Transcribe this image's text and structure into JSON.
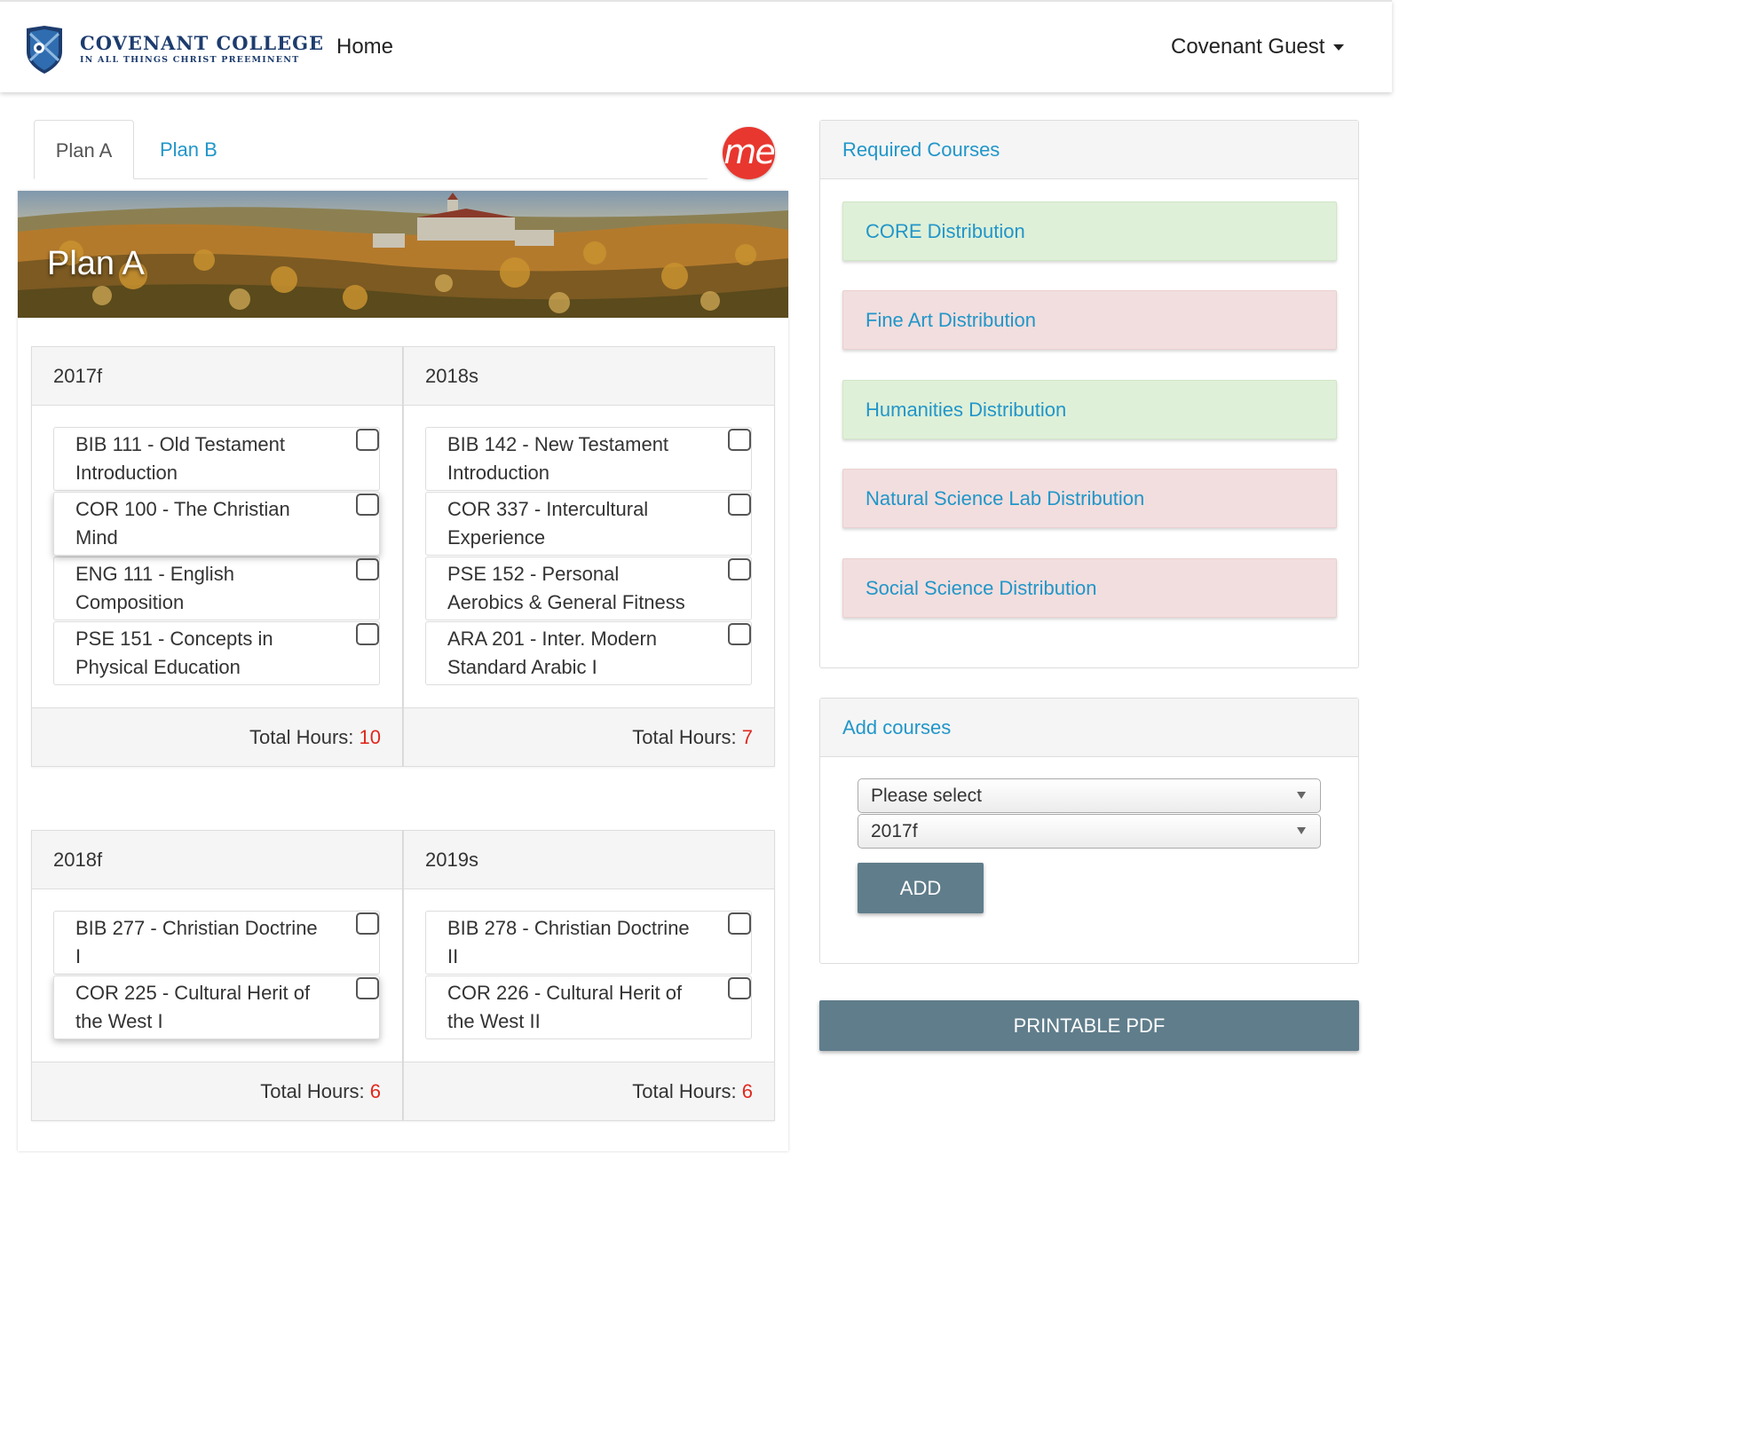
{
  "navbar": {
    "brand_name": "COVENANT COLLEGE",
    "brand_motto": "IN ALL THINGS CHRIST PREEMINENT",
    "home": "Home",
    "user": "Covenant Guest"
  },
  "tabs": [
    {
      "label": "Plan A",
      "active": true
    },
    {
      "label": "Plan B",
      "active": false
    }
  ],
  "me_badge": "me",
  "plan": {
    "title": "Plan A",
    "total_label": "Total Hours: ",
    "semesters": [
      {
        "term": "2017f",
        "courses": [
          "BIB 111 - Old Testament Introduction",
          "COR 100 - The Christian Mind",
          "ENG 111 - English Composition",
          "PSE 151 - Concepts in Physical Education"
        ],
        "total_hours": "10"
      },
      {
        "term": "2018s",
        "courses": [
          "BIB 142 - New Testament Introduction",
          "COR 337 - Intercultural Experience",
          "PSE 152 - Personal Aerobics & General Fitness",
          "ARA 201 - Inter. Modern Standard Arabic I"
        ],
        "total_hours": "7"
      },
      {
        "term": "2018f",
        "courses": [
          "BIB 277 - Christian Doctrine I",
          "COR 225 - Cultural Herit of the West I"
        ],
        "total_hours": "6"
      },
      {
        "term": "2019s",
        "courses": [
          "BIB 278 - Christian Doctrine II",
          "COR 226 - Cultural Herit of the West II"
        ],
        "total_hours": "6"
      }
    ]
  },
  "required": {
    "title": "Required Courses",
    "items": [
      {
        "label": "CORE Distribution",
        "status": "complete"
      },
      {
        "label": "Fine Art Distribution",
        "status": "incomplete"
      },
      {
        "label": "Humanities Distribution",
        "status": "complete"
      },
      {
        "label": "Natural Science Lab Distribution",
        "status": "incomplete"
      },
      {
        "label": "Social Science Distribution",
        "status": "incomplete"
      }
    ]
  },
  "add_courses": {
    "title": "Add courses",
    "course_select": "Please select",
    "term_select": "2017f",
    "add_button": "ADD"
  },
  "pdf_button": "PRINTABLE PDF",
  "colors": {
    "link": "#2196c9",
    "complete_bg": "#dff0d8",
    "incomplete_bg": "#f2dede",
    "button": "#607d8b",
    "hours": "#e0281d",
    "me_badge": "#e8372f"
  }
}
